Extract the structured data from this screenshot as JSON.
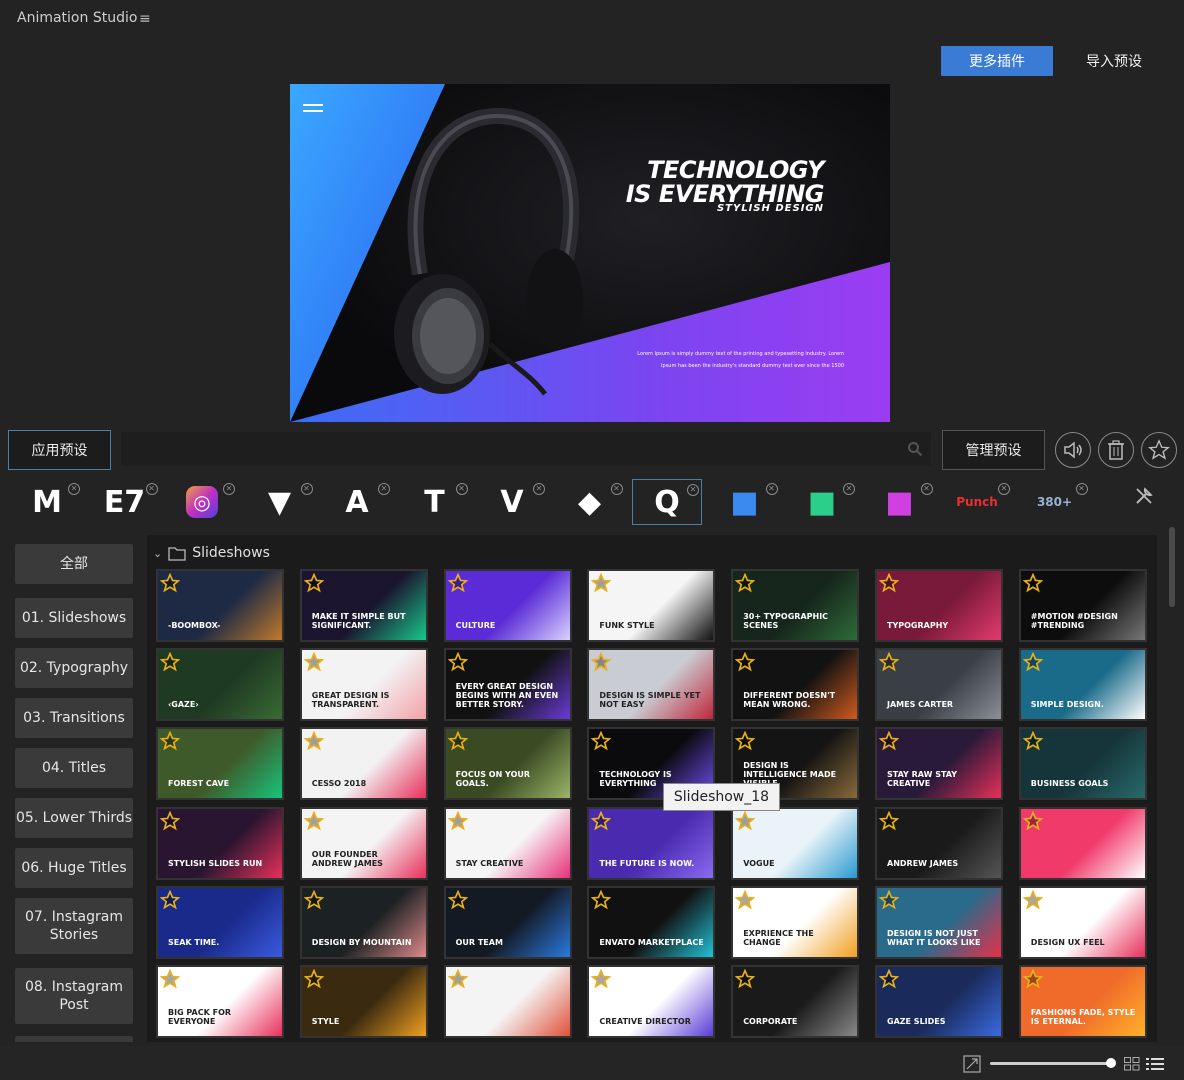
{
  "app": {
    "title": "Animation Studio"
  },
  "header": {
    "more_plugins": "更多插件",
    "import_presets": "导入预设"
  },
  "preview": {
    "headline_line1": "TECHNOLOGY",
    "headline_line2": "IS EVERYTHING",
    "subheadline": "STYLISH DESIGN",
    "body": "Lorem Ipsum is simply dummy text of the printing and typesetting industry. Lorem Ipsum has been the industry's standard dummy text ever since the 1500"
  },
  "toolbar": {
    "apply_preset": "应用预设",
    "search_placeholder": "",
    "manage_presets": "管理预设"
  },
  "plugins": [
    {
      "name": "m-logo",
      "glyph": "M"
    },
    {
      "name": "ey-logo",
      "glyph": "E7"
    },
    {
      "name": "instagram-logo",
      "glyph": "◎"
    },
    {
      "name": "chevron-badge-logo",
      "glyph": "▼"
    },
    {
      "name": "a-logo",
      "glyph": "A"
    },
    {
      "name": "t-logo",
      "glyph": "T"
    },
    {
      "name": "v-logo",
      "glyph": "V"
    },
    {
      "name": "nodes-logo",
      "glyph": "◆"
    },
    {
      "name": "q-logo",
      "glyph": "Q"
    },
    {
      "name": "blue-cube-logo",
      "glyph": "■"
    },
    {
      "name": "green-cube-logo",
      "glyph": "■"
    },
    {
      "name": "pink-cube-logo",
      "glyph": "■"
    },
    {
      "name": "punch-logo",
      "glyph": "Punch"
    },
    {
      "name": "transitions-logo",
      "glyph": "380+"
    }
  ],
  "categories": [
    "全部",
    "01. Slideshows",
    "02. Typography",
    "03. Transitions",
    "04. Titles",
    "05. Lower Thirds",
    "06. Huge Titles",
    "07. Instagram\nStories",
    "08. Instagram\nPost"
  ],
  "gallery": {
    "folder": "Slideshows",
    "tooltip": "Slideshow_18",
    "thumbs": [
      {
        "caption": "-BOOMBOX-",
        "bg": "#1e2a44",
        "accent": "#c07a2a"
      },
      {
        "caption": "MAKE IT SIMPLE BUT SIGNIFICANT.",
        "bg": "#1b1530",
        "accent": "#18c98a"
      },
      {
        "caption": "CULTURE",
        "bg": "#5a2bd6",
        "accent": "#d9d2ff"
      },
      {
        "caption": "Funk Style",
        "bg": "#f5f5f5",
        "accent": "#111111"
      },
      {
        "caption": "30+ TYPOGRAPHIC SCENES",
        "bg": "#16261c",
        "accent": "#2f6b3a"
      },
      {
        "caption": "TYPOGRAPHY",
        "bg": "#7a1a3a",
        "accent": "#e23b6d"
      },
      {
        "caption": "#MOTION #DESIGN #TRENDING",
        "bg": "#0d0d0d",
        "accent": "#777777"
      },
      {
        "caption": "‹GAZE›",
        "bg": "#1f3a22",
        "accent": "#3a6b34"
      },
      {
        "caption": "Great design is transparent.",
        "bg": "#f3f3f3",
        "accent": "#f2a0a8"
      },
      {
        "caption": "EVERY GREAT DESIGN BEGINS WITH AN EVEN BETTER STORY.",
        "bg": "#111111",
        "accent": "#6a3bd6"
      },
      {
        "caption": "DESIGN IS SIMPLE YET NOT EASY",
        "bg": "#c9ccd2",
        "accent": "#c0263a"
      },
      {
        "caption": "DIFFERENT DOESN'T MEAN WRONG.",
        "bg": "#121212",
        "accent": "#d05a1e"
      },
      {
        "caption": "JAMES CARTER",
        "bg": "#3a3f46",
        "accent": "#8a8f98"
      },
      {
        "caption": "SIMPLE DESIGN.",
        "bg": "#1a6b8a",
        "accent": "#ffffff"
      },
      {
        "caption": "Forest Cave",
        "bg": "#3f5a2a",
        "accent": "#17c47a"
      },
      {
        "caption": "CESSO 2018",
        "bg": "#f2f2f2",
        "accent": "#e8305a"
      },
      {
        "caption": "FOCUS ON YOUR GOALS.",
        "bg": "#3a4a22",
        "accent": "#9ab56a"
      },
      {
        "caption": "TECHNOLOGY IS EVERYTHING",
        "bg": "#0b0b0e",
        "accent": "#6f4cf0"
      },
      {
        "caption": "Design is intelligence made visible",
        "bg": "#141414",
        "accent": "#8a6a3a"
      },
      {
        "caption": "STAY RAW STAY CREATIVE",
        "bg": "#2a1a3a",
        "accent": "#e8305a"
      },
      {
        "caption": "BUSINESS GOALS",
        "bg": "#15353a",
        "accent": "#2a6a6a"
      },
      {
        "caption": "STYLISH SLIDES RUN",
        "bg": "#2a1530",
        "accent": "#e8305a"
      },
      {
        "caption": "OUR FOUNDER ANDREW JAMES",
        "bg": "#f4f4f4",
        "accent": "#e8305a"
      },
      {
        "caption": "STAY CREATIVE",
        "bg": "#f5f5f5",
        "accent": "#e8307a"
      },
      {
        "caption": "THE FUTURE IS NOW.",
        "bg": "#4a2bb0",
        "accent": "#8a6af0"
      },
      {
        "caption": "VOGUE",
        "bg": "#eaf3f8",
        "accent": "#2a9ad0"
      },
      {
        "caption": "Andrew James",
        "bg": "#1a1a1a",
        "accent": "#555555"
      },
      {
        "caption": "",
        "bg": "#f03a6a",
        "accent": "#ffffff"
      },
      {
        "caption": "SEAK TIME.",
        "bg": "#1a2a8a",
        "accent": "#3a5ae0"
      },
      {
        "caption": "DESIGN BY MOUNTAIN",
        "bg": "#1c2224",
        "accent": "#e08a8a"
      },
      {
        "caption": "OUR TEAM",
        "bg": "#141a24",
        "accent": "#2a7ae0"
      },
      {
        "caption": "ENVATO MARKETPLACE",
        "bg": "#111111",
        "accent": "#21c3d6"
      },
      {
        "caption": "EXPRIENCE THE CHANGE",
        "bg": "#ffffff",
        "accent": "#f0a020"
      },
      {
        "caption": "DESIGN IS NOT JUST WHAT IT LOOKS LIKE",
        "bg": "#2a6a8a",
        "accent": "#e8304a"
      },
      {
        "caption": "DESIGN UX FEEL",
        "bg": "#ffffff",
        "accent": "#e8305a"
      },
      {
        "caption": "BIG PACK FOR EVERYONE",
        "bg": "#ffffff",
        "accent": "#e8305a"
      },
      {
        "caption": "STYLE",
        "bg": "#3a2a10",
        "accent": "#f0a020"
      },
      {
        "caption": "",
        "bg": "#f4f4f4",
        "accent": "#e0503a"
      },
      {
        "caption": "CREATIVE DIRECTOR",
        "bg": "#ffffff",
        "accent": "#5a3bd6"
      },
      {
        "caption": "CORPORATE",
        "bg": "#1a1a1a",
        "accent": "#888888"
      },
      {
        "caption": "GAZE SLIDES",
        "bg": "#1a2a5a",
        "accent": "#3a6ae0"
      },
      {
        "caption": "Fashions fade, style is eternal.",
        "bg": "#f06a2a",
        "accent": "#ffb02a"
      }
    ]
  },
  "colors": {
    "accent_blue": "#3a7bd5",
    "star_gold": "#e8b01a"
  }
}
